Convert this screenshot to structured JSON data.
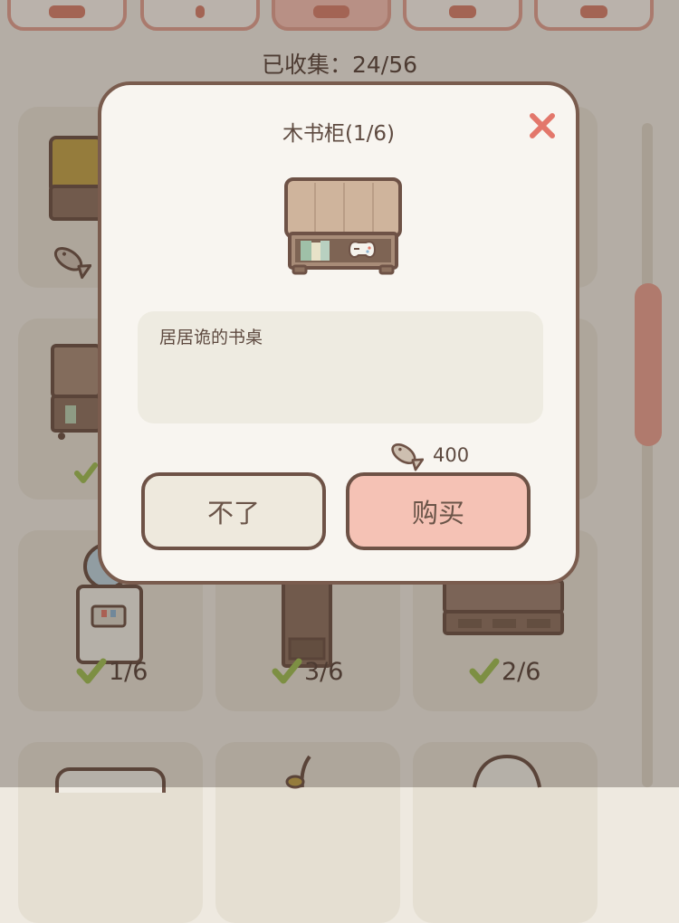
{
  "header": {
    "collected_label": "已收集：24/56",
    "tabs": [
      {
        "icon": "category-tab-icon",
        "active": false
      },
      {
        "icon": "category-tab-icon",
        "active": false
      },
      {
        "icon": "category-tab-icon",
        "active": true
      },
      {
        "icon": "category-tab-icon",
        "active": false
      },
      {
        "icon": "category-tab-icon",
        "active": false
      }
    ]
  },
  "grid": {
    "counts": [
      "1/6",
      "3/6",
      "2/6"
    ]
  },
  "dialog": {
    "title": "木书柜(1/6)",
    "description": "居居诡的书桌",
    "price": "400",
    "cancel_label": "不了",
    "buy_label": "购买",
    "close_icon": "close-icon",
    "currency_icon": "fish-currency-icon"
  },
  "colors": {
    "close": "#e3776b",
    "buy_button": "#f5c2b5",
    "cancel_button": "#eee9dd",
    "dialog_border": "#7a5c4e",
    "check": "#9fbd54"
  }
}
